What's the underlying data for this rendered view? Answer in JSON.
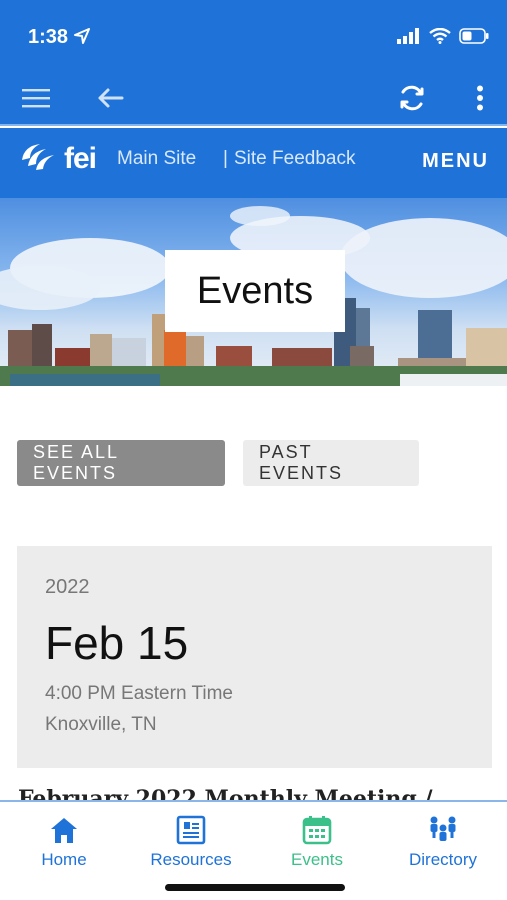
{
  "status": {
    "time": "1:38"
  },
  "site_header": {
    "logo_text": "fei",
    "nav_main": "Main Site",
    "nav_sep": "|",
    "nav_feedback": "Site Feedback",
    "menu_label": "MENU"
  },
  "hero": {
    "title": "Events"
  },
  "buttons": {
    "see_all": "SEE ALL EVENTS",
    "past": "PAST EVENTS"
  },
  "event": {
    "year": "2022",
    "date": "Feb 15",
    "time": "4:00 PM Eastern Time",
    "location": "Knoxville, TN",
    "title": "February 2022 Monthly Meeting /"
  },
  "tabs": [
    {
      "label": "Home",
      "icon": "home-icon"
    },
    {
      "label": "Resources",
      "icon": "resources-icon"
    },
    {
      "label": "Events",
      "icon": "calendar-icon"
    },
    {
      "label": "Directory",
      "icon": "directory-icon"
    }
  ],
  "colors": {
    "brand_blue": "#1f73d8",
    "active_tab": "#3cc08a",
    "card_bg": "#ececec"
  }
}
